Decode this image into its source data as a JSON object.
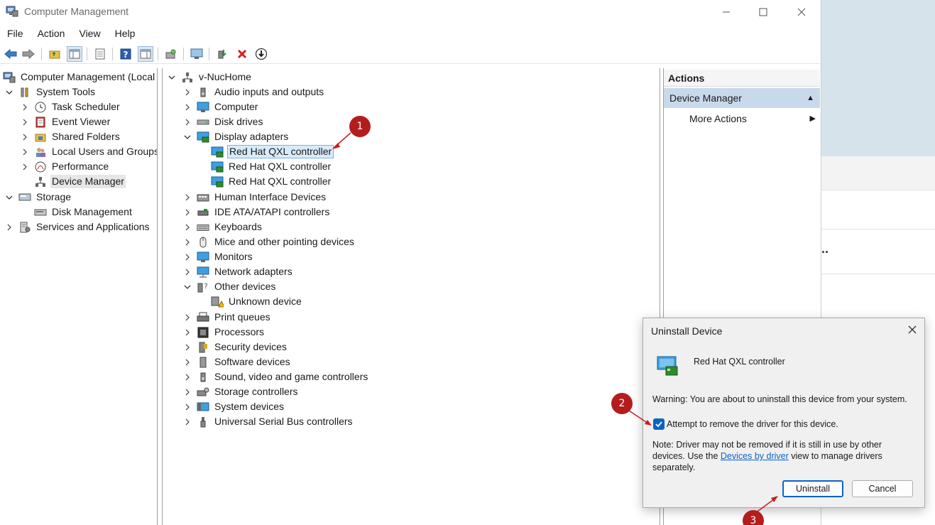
{
  "window": {
    "title": "Computer Management",
    "menu": [
      "File",
      "Action",
      "View",
      "Help"
    ]
  },
  "left_tree": [
    {
      "label": "Computer Management (Local",
      "icon": "computer-management-icon"
    },
    {
      "label": "System Tools",
      "icon": "tools-icon"
    },
    {
      "label": "Task Scheduler",
      "icon": "clock-icon"
    },
    {
      "label": "Event Viewer",
      "icon": "event-viewer-icon"
    },
    {
      "label": "Shared Folders",
      "icon": "shared-folder-icon"
    },
    {
      "label": "Local Users and Groups",
      "icon": "users-icon"
    },
    {
      "label": "Performance",
      "icon": "performance-icon"
    },
    {
      "label": "Device Manager",
      "icon": "device-manager-icon"
    },
    {
      "label": "Storage",
      "icon": "storage-icon"
    },
    {
      "label": "Disk Management",
      "icon": "disk-management-icon"
    },
    {
      "label": "Services and Applications",
      "icon": "services-icon"
    }
  ],
  "device_tree": {
    "root": "v-NucHome",
    "items": [
      "Audio inputs and outputs",
      "Computer",
      "Disk drives",
      "Display adapters",
      "Red Hat QXL controller",
      "Red Hat QXL controller",
      "Red Hat QXL controller",
      "Human Interface Devices",
      "IDE ATA/ATAPI controllers",
      "Keyboards",
      "Mice and other pointing devices",
      "Monitors",
      "Network adapters",
      "Other devices",
      "Unknown device",
      "Print queues",
      "Processors",
      "Security devices",
      "Software devices",
      "Sound, video and game controllers",
      "Storage controllers",
      "System devices",
      "Universal Serial Bus controllers"
    ]
  },
  "actions": {
    "header": "Actions",
    "group": "Device Manager",
    "item": "More Actions"
  },
  "dialog": {
    "title": "Uninstall Device",
    "device_name": "Red Hat QXL controller",
    "warning": "Warning: You are about to uninstall this device from your system.",
    "checkbox_label": "Attempt to remove the driver for this device.",
    "checkbox_checked": true,
    "note_before": "Note: Driver may not be removed if it is still in use by other devices. Use the ",
    "note_link": "Devices by driver",
    "note_after": " view to manage drivers separately.",
    "uninstall_button": "Uninstall",
    "cancel_button": "Cancel"
  },
  "markers": [
    "1",
    "2",
    "3"
  ],
  "colors": {
    "marker": "#b41d1d",
    "accent": "#0b63c9",
    "selection": "#d8ebfa",
    "actions_group": "#c9d9ec"
  }
}
